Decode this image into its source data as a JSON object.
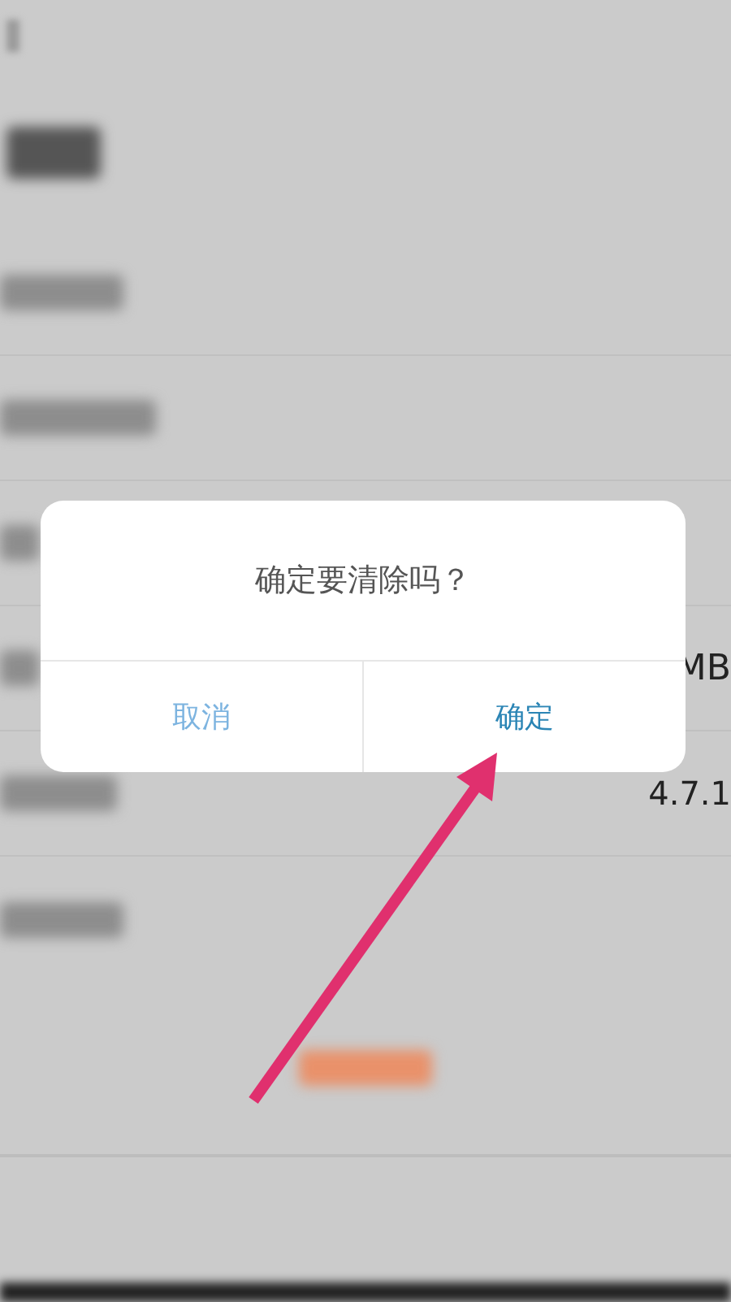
{
  "settings_values": [
    {
      "text": "MB"
    },
    {
      "text": "4.7.1"
    }
  ],
  "dialog": {
    "message": "确定要清除吗？",
    "buttons": [
      {
        "label": "取消",
        "kind": "cancel"
      },
      {
        "label": "确定",
        "kind": "confirm"
      }
    ]
  }
}
